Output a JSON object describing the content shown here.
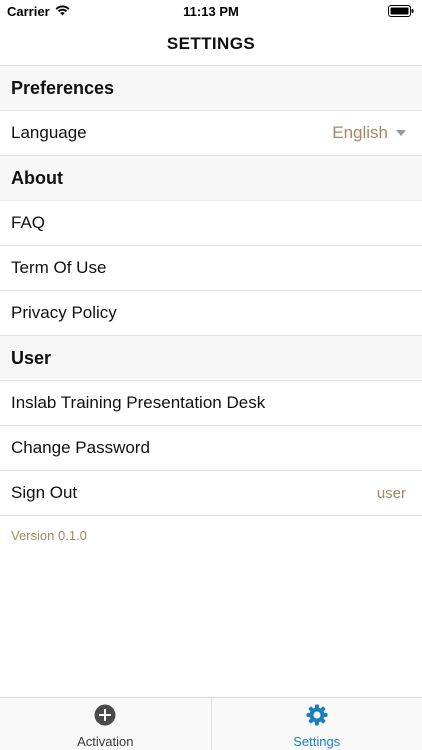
{
  "status": {
    "carrier": "Carrier",
    "time": "11:13 PM"
  },
  "nav": {
    "title": "SETTINGS"
  },
  "sections": {
    "preferences": {
      "header": "Preferences",
      "language_label": "Language",
      "language_value": "English"
    },
    "about": {
      "header": "About",
      "faq": "FAQ",
      "terms": "Term Of Use",
      "privacy": "Privacy Policy"
    },
    "user": {
      "header": "User",
      "account_name": "Inslab Training Presentation Desk",
      "change_password": "Change Password",
      "sign_out": "Sign Out",
      "sign_out_value": "user"
    }
  },
  "version": "Version 0.1.0",
  "tabs": {
    "activation": {
      "label": "Activation",
      "icon": "plus-circle-icon"
    },
    "settings": {
      "label": "Settings",
      "icon": "gear-icon",
      "active": true
    }
  },
  "colors": {
    "accent": "#1a7fc1",
    "value_text": "#a28a62",
    "section_bg": "#f7f7f7"
  }
}
